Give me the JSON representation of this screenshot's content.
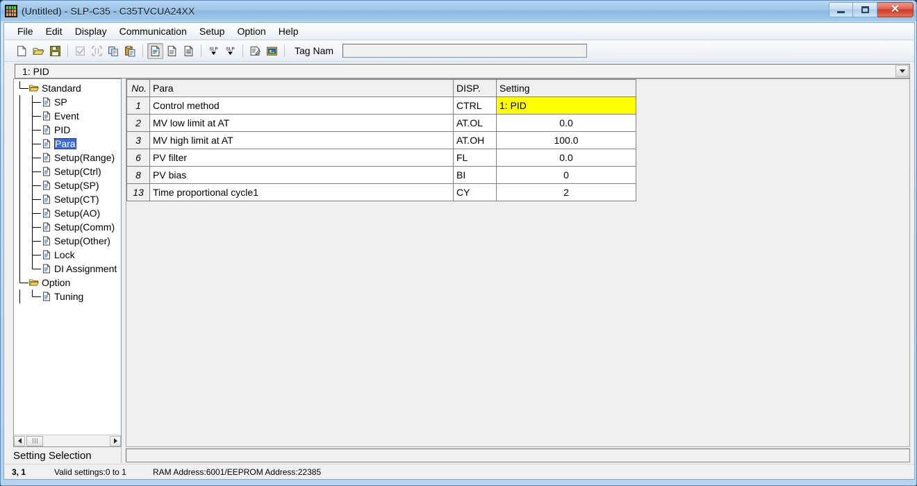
{
  "window": {
    "title": "(Untitled) - SLP-C35 - C35TVCUA24XX",
    "app_icon": "controller-display-icon",
    "minimize_label": "Minimize",
    "maximize_label": "Maximize",
    "close_label": "Close"
  },
  "menubar": {
    "items": [
      {
        "label": "File"
      },
      {
        "label": "Edit"
      },
      {
        "label": "Display"
      },
      {
        "label": "Communication"
      },
      {
        "label": "Setup"
      },
      {
        "label": "Option"
      },
      {
        "label": "Help"
      }
    ]
  },
  "toolbar": {
    "buttons": [
      {
        "name": "new-file-icon",
        "tooltip": "New"
      },
      {
        "name": "open-folder-icon",
        "tooltip": "Open"
      },
      {
        "name": "save-floppy-icon",
        "tooltip": "Save"
      },
      {
        "name": "checkmark-icon",
        "tooltip": "Check",
        "disabled": true
      },
      {
        "name": "select-frame-icon",
        "tooltip": "Select",
        "disabled": true
      },
      {
        "name": "copy-icon",
        "tooltip": "Copy"
      },
      {
        "name": "paste-icon",
        "tooltip": "Paste"
      },
      {
        "name": "document-list-icon",
        "tooltip": "List view",
        "pressed": true
      },
      {
        "name": "document-detail-icon",
        "tooltip": "Detail view"
      },
      {
        "name": "document-text-icon",
        "tooltip": "Text view"
      },
      {
        "name": "slp-download-icon",
        "tooltip": "SLP download"
      },
      {
        "name": "slp-upload-icon",
        "tooltip": "SLP upload"
      },
      {
        "name": "properties-icon",
        "tooltip": "Properties"
      },
      {
        "name": "device-image-icon",
        "tooltip": "Device"
      }
    ],
    "tag_name_label": "Tag Nam",
    "tag_name_value": "",
    "tag_name_placeholder": ""
  },
  "selector": {
    "value": "1: PID",
    "arrow_icon": "chevron-down-icon"
  },
  "tree": {
    "items": [
      {
        "label": "Standard",
        "level": 0,
        "icon": "open-folder-icon",
        "selected": false,
        "last": false
      },
      {
        "label": "SP",
        "level": 1,
        "icon": "document-icon",
        "selected": false,
        "last": false
      },
      {
        "label": "Event",
        "level": 1,
        "icon": "document-icon",
        "selected": false,
        "last": false
      },
      {
        "label": "PID",
        "level": 1,
        "icon": "document-icon",
        "selected": false,
        "last": false
      },
      {
        "label": "Para",
        "level": 1,
        "icon": "document-icon",
        "selected": true,
        "last": false
      },
      {
        "label": "Setup(Range)",
        "level": 1,
        "icon": "document-icon",
        "selected": false,
        "last": false
      },
      {
        "label": "Setup(Ctrl)",
        "level": 1,
        "icon": "document-icon",
        "selected": false,
        "last": false
      },
      {
        "label": "Setup(SP)",
        "level": 1,
        "icon": "document-icon",
        "selected": false,
        "last": false
      },
      {
        "label": "Setup(CT)",
        "level": 1,
        "icon": "document-icon",
        "selected": false,
        "last": false
      },
      {
        "label": "Setup(AO)",
        "level": 1,
        "icon": "document-icon",
        "selected": false,
        "last": false
      },
      {
        "label": "Setup(Comm)",
        "level": 1,
        "icon": "document-icon",
        "selected": false,
        "last": false
      },
      {
        "label": "Setup(Other)",
        "level": 1,
        "icon": "document-icon",
        "selected": false,
        "last": false
      },
      {
        "label": "Lock",
        "level": 1,
        "icon": "document-icon",
        "selected": false,
        "last": false
      },
      {
        "label": "DI Assignment",
        "level": 1,
        "icon": "document-icon",
        "selected": false,
        "last": true
      },
      {
        "label": "Option",
        "level": 0,
        "icon": "open-folder-icon",
        "selected": false,
        "last": true
      },
      {
        "label": "Tuning",
        "level": 1,
        "icon": "document-icon",
        "selected": false,
        "last": true
      }
    ],
    "scroll_left_icon": "arrow-left-icon",
    "scroll_right_icon": "arrow-right-icon"
  },
  "table": {
    "columns": [
      {
        "key": "no",
        "label": "No."
      },
      {
        "key": "para",
        "label": "Para"
      },
      {
        "key": "disp",
        "label": "DISP."
      },
      {
        "key": "setting",
        "label": "Setting"
      }
    ],
    "rows": [
      {
        "no": "1",
        "para": "Control method",
        "disp": "CTRL",
        "setting": "1: PID",
        "selected": true
      },
      {
        "no": "2",
        "para": "MV low limit at AT",
        "disp": "AT.OL",
        "setting": "0.0",
        "selected": false
      },
      {
        "no": "3",
        "para": "MV high limit at AT",
        "disp": "AT.OH",
        "setting": "100.0",
        "selected": false
      },
      {
        "no": "6",
        "para": "PV filter",
        "disp": "FL",
        "setting": "0.0",
        "selected": false
      },
      {
        "no": "8",
        "para": "PV bias",
        "disp": "BI",
        "setting": "0",
        "selected": false
      },
      {
        "no": "13",
        "para": "Time proportional cycle1",
        "disp": "CY",
        "setting": "2",
        "selected": false
      }
    ],
    "selected_cell_color": "#ffff00"
  },
  "bottom_panel": {
    "title": "Setting Selection",
    "field_value": ""
  },
  "statusbar": {
    "position": "3, 1",
    "valid_settings": "Valid settings:0 to 1",
    "address": "RAM Address:6001/EEPROM Address:22385"
  }
}
